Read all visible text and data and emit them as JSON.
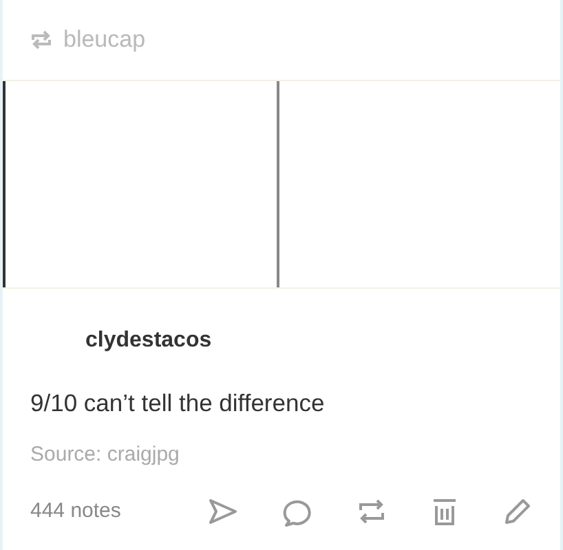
{
  "reblog_header": {
    "username": "bleucap"
  },
  "post": {
    "author": "clydestacos",
    "text": "9/10 can’t tell the difference",
    "source": "Source: craigjpg"
  },
  "footer": {
    "notes": "444 notes"
  }
}
